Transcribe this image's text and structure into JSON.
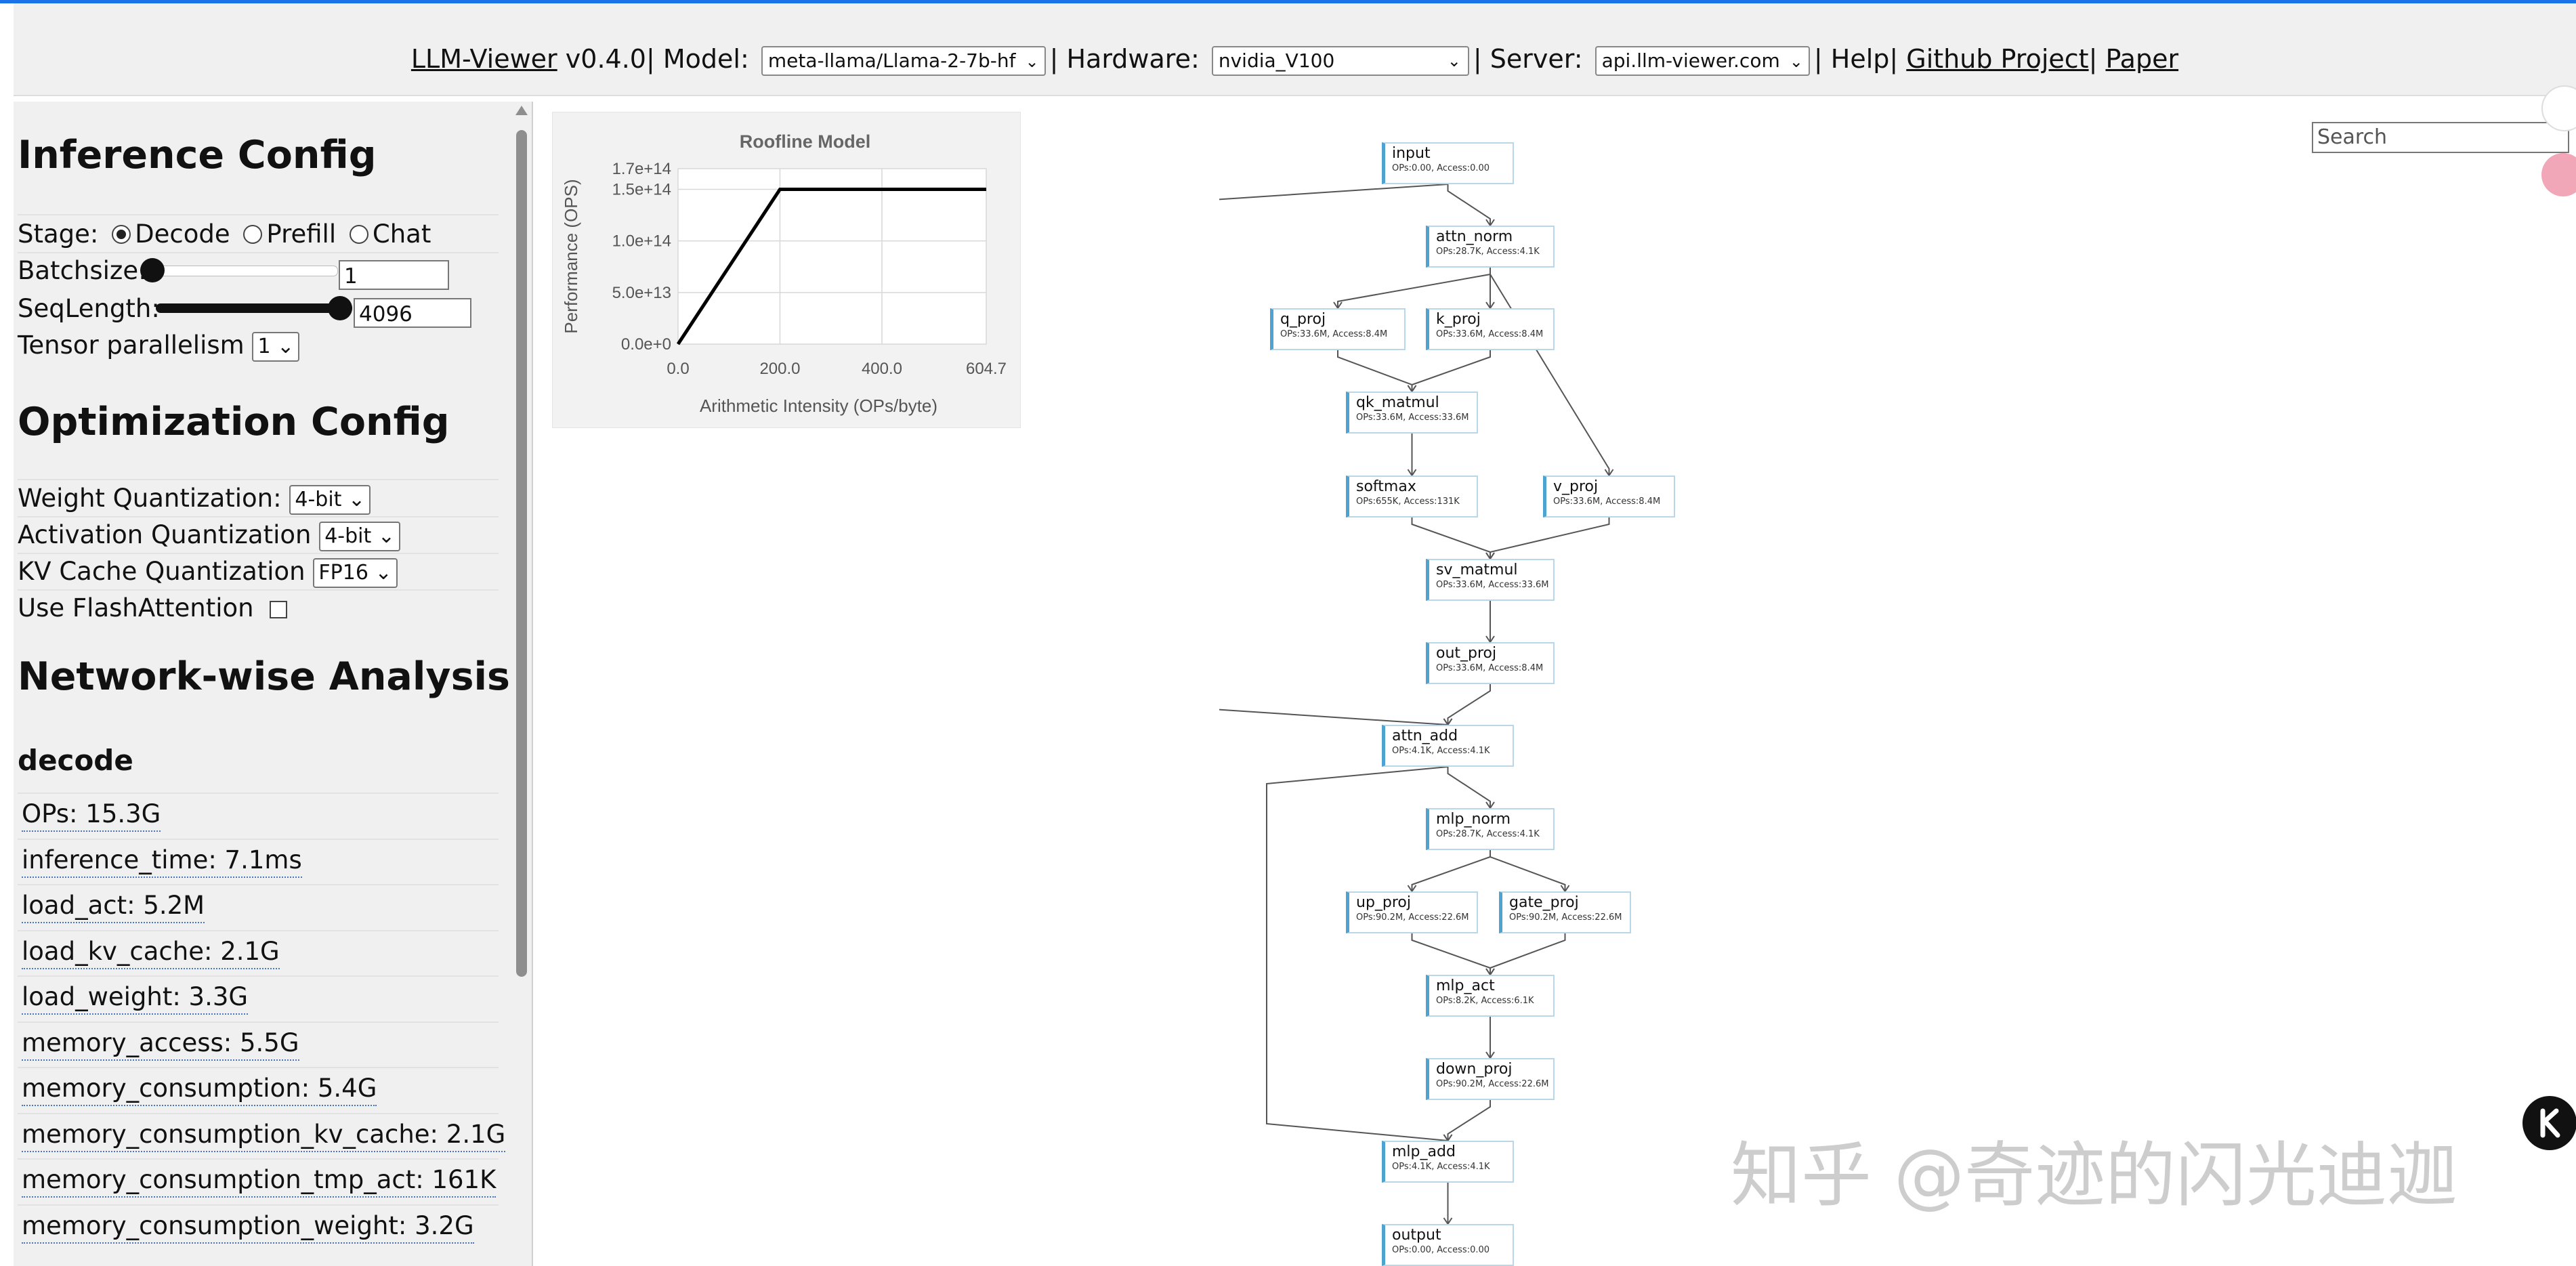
{
  "header": {
    "app_name": "LLM-Viewer",
    "version": "v0.4.0",
    "model_label": "Model:",
    "model_value": "meta-llama/Llama-2-7b-hf",
    "hardware_label": "Hardware:",
    "hardware_value": "nvidia_V100",
    "server_label": "Server:",
    "server_value": "api.llm-viewer.com",
    "help": "Help",
    "github": "Github Project",
    "paper": "Paper"
  },
  "sidebar": {
    "inference_title": "Inference Config",
    "stage_label": "Stage:",
    "stage_options": [
      "Decode",
      "Prefill",
      "Chat"
    ],
    "stage_selected": "Decode",
    "batchsize_label": "Batchsize:",
    "batchsize_value": "1",
    "batchsize_slider_fraction": 0.0,
    "seqlength_label": "SeqLength:",
    "seqlength_value": "4096",
    "seqlength_slider_fraction": 1.0,
    "tp_label": "Tensor parallelism",
    "tp_value": "1",
    "optimization_title": "Optimization Config",
    "weight_quant_label": "Weight Quantization:",
    "weight_quant_value": "4-bit",
    "act_quant_label": "Activation Quantization",
    "act_quant_value": "4-bit",
    "kv_quant_label": "KV Cache Quantization",
    "kv_quant_value": "FP16",
    "flash_label": "Use FlashAttention",
    "flash_checked": false,
    "network_title": "Network-wise Analysis",
    "decode_title": "decode",
    "stats": [
      "OPs: 15.3G",
      "inference_time: 7.1ms",
      "load_act: 5.2M",
      "load_kv_cache: 2.1G",
      "load_weight: 3.3G",
      "memory_access: 5.5G",
      "memory_consumption: 5.4G",
      "memory_consumption_kv_cache: 2.1G",
      "memory_consumption_tmp_act: 161K",
      "memory_consumption_weight: 3.2G"
    ]
  },
  "search": {
    "placeholder": "Search"
  },
  "watermark": "知乎 @奇迹的闪光迪迦",
  "chart_data": {
    "type": "line",
    "title": "Roofline Model",
    "xlabel": "Arithmetic Intensity (OPs/byte)",
    "ylabel": "Performance (OPS)",
    "x_ticks": [
      "0.0",
      "200.0",
      "400.0",
      "604.7"
    ],
    "y_ticks": [
      "0.0e+0",
      "5.0e+13",
      "1.0e+14",
      "1.5e+14",
      "1.7e+14"
    ],
    "xlim": [
      0,
      604.7
    ],
    "ylim": [
      0,
      170000000000000.0
    ],
    "grid": true,
    "series": [
      {
        "x": [
          0,
          200,
          604.7
        ],
        "y": [
          0,
          150000000000000.0,
          150000000000000.0
        ]
      }
    ]
  },
  "graph": {
    "nodes": [
      {
        "id": "input",
        "name": "input",
        "meta": "OPs:0.00, Access:0.00"
      },
      {
        "id": "attn_norm",
        "name": "attn_norm",
        "meta": "OPs:28.7K, Access:4.1K"
      },
      {
        "id": "q_proj",
        "name": "q_proj",
        "meta": "OPs:33.6M, Access:8.4M"
      },
      {
        "id": "k_proj",
        "name": "k_proj",
        "meta": "OPs:33.6M, Access:8.4M"
      },
      {
        "id": "qk_matmul",
        "name": "qk_matmul",
        "meta": "OPs:33.6M, Access:33.6M"
      },
      {
        "id": "softmax",
        "name": "softmax",
        "meta": "OPs:655K, Access:131K"
      },
      {
        "id": "v_proj",
        "name": "v_proj",
        "meta": "OPs:33.6M, Access:8.4M"
      },
      {
        "id": "sv_matmul",
        "name": "sv_matmul",
        "meta": "OPs:33.6M, Access:33.6M"
      },
      {
        "id": "out_proj",
        "name": "out_proj",
        "meta": "OPs:33.6M, Access:8.4M"
      },
      {
        "id": "attn_add",
        "name": "attn_add",
        "meta": "OPs:4.1K, Access:4.1K"
      },
      {
        "id": "mlp_norm",
        "name": "mlp_norm",
        "meta": "OPs:28.7K, Access:4.1K"
      },
      {
        "id": "up_proj",
        "name": "up_proj",
        "meta": "OPs:90.2M, Access:22.6M"
      },
      {
        "id": "gate_proj",
        "name": "gate_proj",
        "meta": "OPs:90.2M, Access:22.6M"
      },
      {
        "id": "mlp_act",
        "name": "mlp_act",
        "meta": "OPs:8.2K, Access:6.1K"
      },
      {
        "id": "down_proj",
        "name": "down_proj",
        "meta": "OPs:90.2M, Access:22.6M"
      },
      {
        "id": "mlp_add",
        "name": "mlp_add",
        "meta": "OPs:4.1K, Access:4.1K"
      },
      {
        "id": "output",
        "name": "output",
        "meta": "OPs:0.00, Access:0.00"
      }
    ],
    "edges": [
      [
        "input",
        "attn_norm"
      ],
      [
        "input",
        "attn_add"
      ],
      [
        "attn_norm",
        "q_proj"
      ],
      [
        "attn_norm",
        "k_proj"
      ],
      [
        "attn_norm",
        "v_proj"
      ],
      [
        "q_proj",
        "qk_matmul"
      ],
      [
        "k_proj",
        "qk_matmul"
      ],
      [
        "qk_matmul",
        "softmax"
      ],
      [
        "softmax",
        "sv_matmul"
      ],
      [
        "v_proj",
        "sv_matmul"
      ],
      [
        "sv_matmul",
        "out_proj"
      ],
      [
        "out_proj",
        "attn_add"
      ],
      [
        "attn_add",
        "mlp_norm"
      ],
      [
        "attn_add",
        "mlp_add"
      ],
      [
        "mlp_norm",
        "up_proj"
      ],
      [
        "mlp_norm",
        "gate_proj"
      ],
      [
        "up_proj",
        "mlp_act"
      ],
      [
        "gate_proj",
        "mlp_act"
      ],
      [
        "mlp_act",
        "down_proj"
      ],
      [
        "down_proj",
        "mlp_add"
      ],
      [
        "mlp_add",
        "output"
      ]
    ]
  }
}
